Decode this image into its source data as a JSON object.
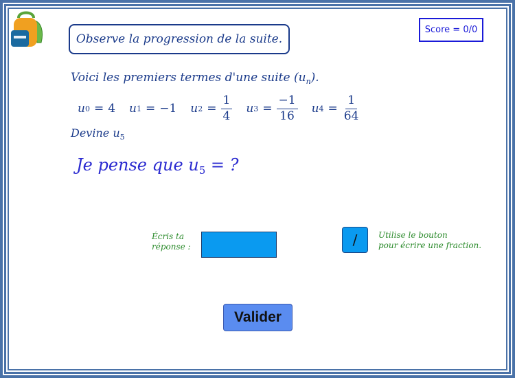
{
  "instruction": "Observe la progression de la suite.",
  "score": {
    "label": "Score = 0/0"
  },
  "intro": {
    "text": "Voici les premiers termes d'une suite (",
    "var": "u",
    "sub": "n",
    "close": ")."
  },
  "terms": [
    {
      "var": "u",
      "index": "0",
      "value": "4"
    },
    {
      "var": "u",
      "index": "1",
      "value": "−1"
    },
    {
      "var": "u",
      "index": "2",
      "numerator": "1",
      "denominator": "4"
    },
    {
      "var": "u",
      "index": "3",
      "numerator": "−1",
      "denominator": "16"
    },
    {
      "var": "u",
      "index": "4",
      "numerator": "1",
      "denominator": "64"
    }
  ],
  "equals": "=",
  "prompt": {
    "text": "Devine ",
    "var": "u",
    "sub": "5"
  },
  "guess": {
    "text": "Je pense que ",
    "var": "u",
    "sub": "5",
    "rest": " = ?"
  },
  "answer": {
    "label_line1": "Écris ta",
    "label_line2": "réponse :",
    "value": ""
  },
  "fraction_button": {
    "label": "/"
  },
  "hint": {
    "line1": "Utilise le bouton",
    "line2": "pour écrire une fraction."
  },
  "submit": {
    "label": "Valider"
  },
  "icons": {
    "bag": "backpack-icon"
  },
  "colors": {
    "frame": "#4a72a8",
    "text": "#1a3a8a",
    "green": "#2a8a2a",
    "input": "#0a9af0",
    "button": "#5a8cf0"
  }
}
